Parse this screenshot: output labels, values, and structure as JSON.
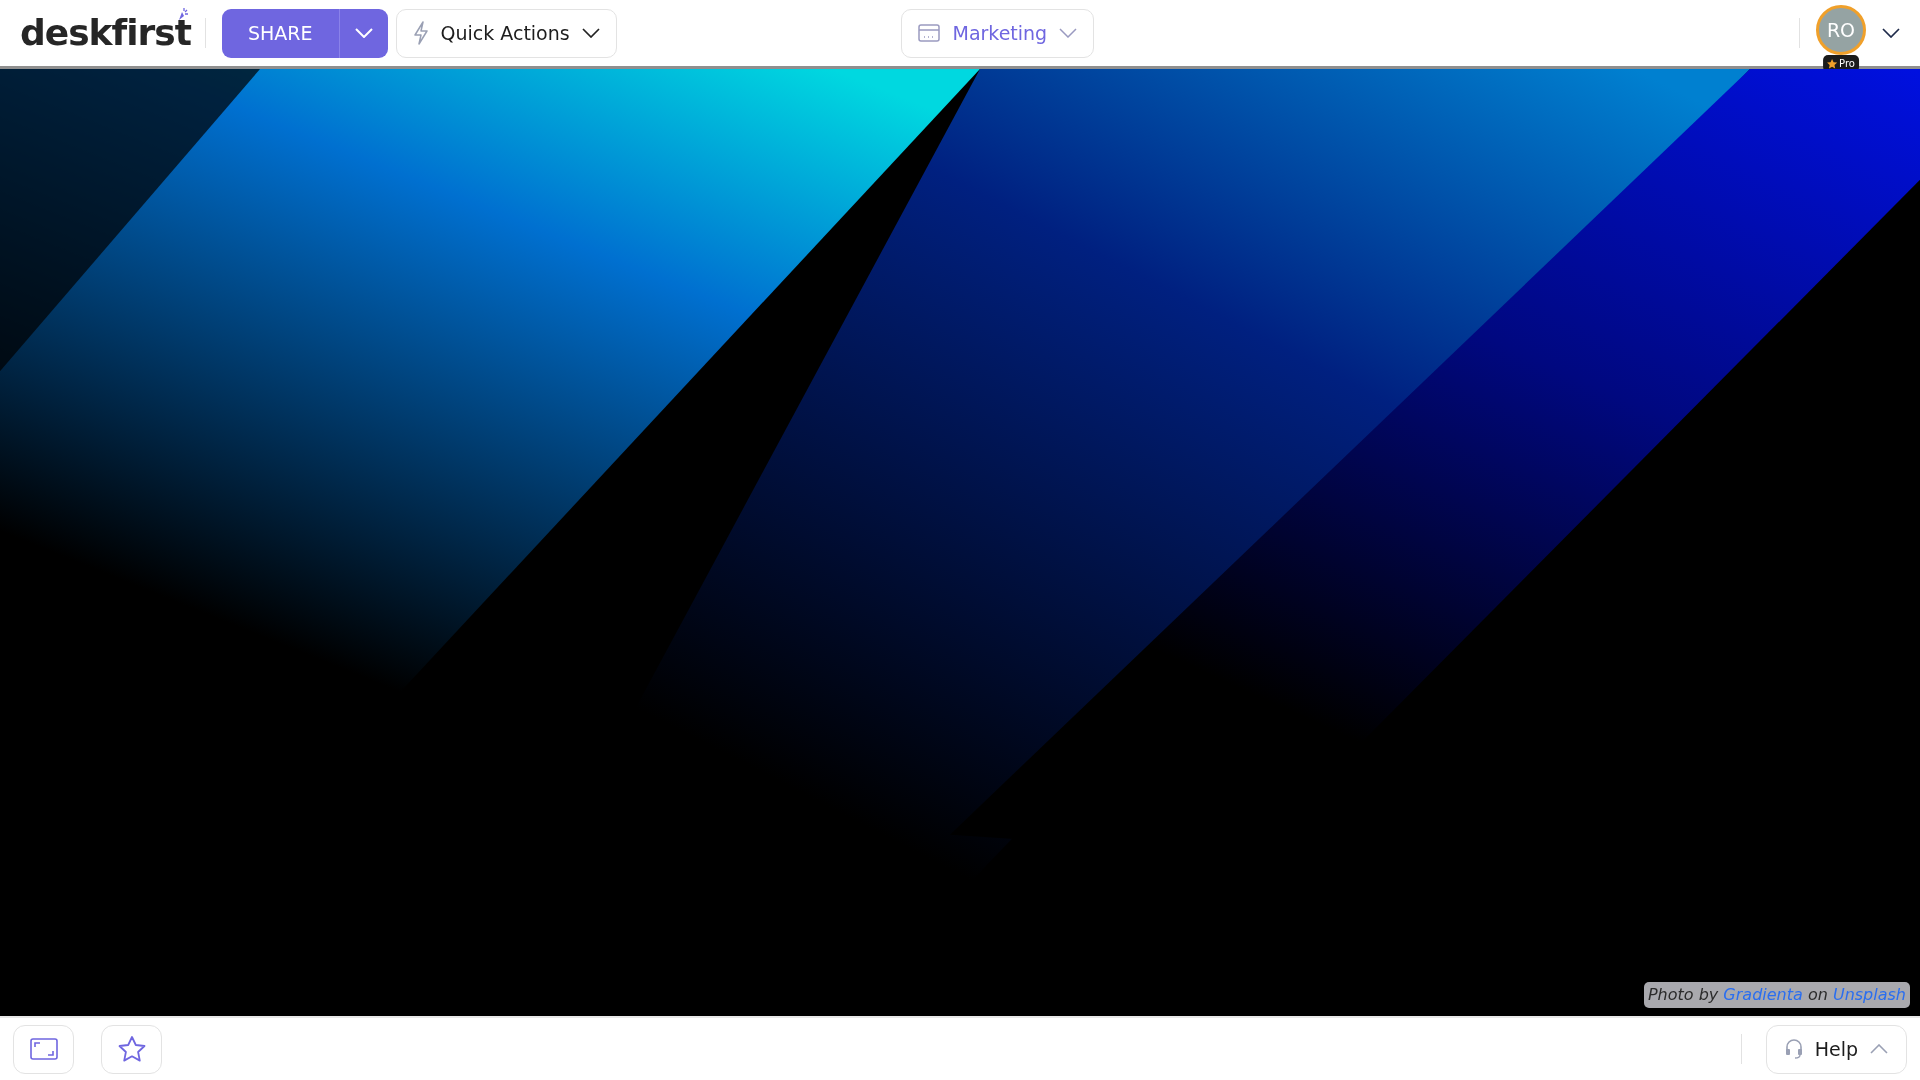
{
  "header": {
    "logo": "deskfirst",
    "share": {
      "label": "SHARE"
    },
    "quick_actions": {
      "label": "Quick Actions"
    },
    "workspace": {
      "label": "Marketing"
    },
    "user": {
      "initials": "RO",
      "badge": "Pro"
    }
  },
  "background": {
    "kind": "picture",
    "credit": {
      "prefix": "Photo by",
      "author": "Gradienta",
      "middle": "on",
      "source": "Unsplash"
    }
  },
  "footer": {
    "help": {
      "label": "Help"
    }
  }
}
